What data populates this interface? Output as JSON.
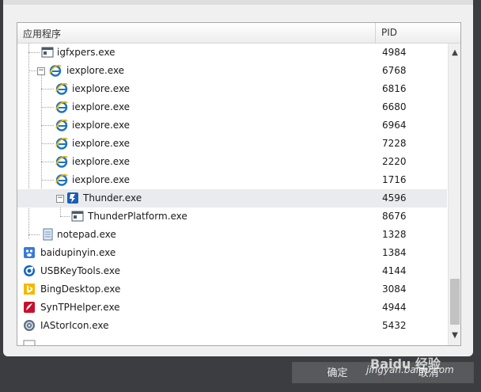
{
  "table": {
    "col_app": "应用程序",
    "col_pid": "PID",
    "rows": [
      {
        "name": "igfxpers.exe",
        "pid": "4984",
        "icon": "window-app-icon"
      },
      {
        "name": "iexplore.exe",
        "pid": "6768",
        "icon": "ie-icon"
      },
      {
        "name": "iexplore.exe",
        "pid": "6816",
        "icon": "ie-icon"
      },
      {
        "name": "iexplore.exe",
        "pid": "6680",
        "icon": "ie-icon"
      },
      {
        "name": "iexplore.exe",
        "pid": "6964",
        "icon": "ie-icon"
      },
      {
        "name": "iexplore.exe",
        "pid": "7228",
        "icon": "ie-icon"
      },
      {
        "name": "iexplore.exe",
        "pid": "2220",
        "icon": "ie-icon"
      },
      {
        "name": "iexplore.exe",
        "pid": "1716",
        "icon": "ie-icon"
      },
      {
        "name": "Thunder.exe",
        "pid": "4596",
        "icon": "thunder-icon"
      },
      {
        "name": "ThunderPlatform.exe",
        "pid": "8676",
        "icon": "window-app-icon"
      },
      {
        "name": "notepad.exe",
        "pid": "1328",
        "icon": "notepad-icon"
      },
      {
        "name": "baidupinyin.exe",
        "pid": "1384",
        "icon": "baidupinyin-icon"
      },
      {
        "name": "USBKeyTools.exe",
        "pid": "4144",
        "icon": "usbkey-icon"
      },
      {
        "name": "BingDesktop.exe",
        "pid": "3084",
        "icon": "bing-icon"
      },
      {
        "name": "SynTPHelper.exe",
        "pid": "4944",
        "icon": "syntp-icon"
      },
      {
        "name": "IAStorIcon.exe",
        "pid": "5432",
        "icon": "iastor-icon"
      }
    ]
  },
  "buttons": {
    "ok": "确定",
    "cancel": "取消"
  },
  "watermark": {
    "site": "jingyan.baidu.com",
    "brand": "Baidu 经验"
  },
  "colors": {
    "selected_row": "#e9ebee",
    "ie_blue": "#1e73be",
    "bing": "#f5b800",
    "syntp": "#c8102e"
  }
}
